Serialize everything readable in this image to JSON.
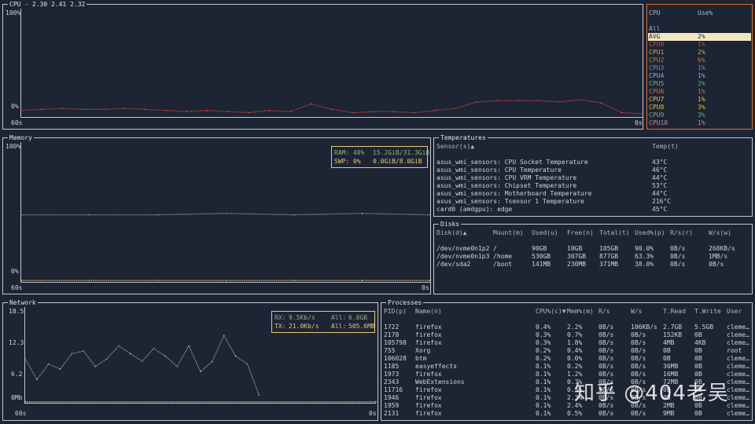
{
  "cpu": {
    "title": "CPU - 2.30 2.41 2.32",
    "y_top": "100%",
    "y_bottom": "0%",
    "x_left": "60s",
    "x_right": "0s",
    "line_color": "#c74848",
    "chart_data": {
      "type": "line",
      "x": [
        60,
        58,
        56,
        54,
        52,
        50,
        48,
        46,
        44,
        42,
        40,
        38,
        36,
        34,
        32,
        30,
        28,
        26,
        24,
        22,
        20,
        18,
        16,
        14,
        12,
        10,
        8,
        6,
        4,
        2,
        0
      ],
      "values": [
        6,
        7,
        8,
        7,
        7,
        8,
        7,
        6,
        5,
        6,
        5,
        4,
        6,
        5,
        12,
        7,
        4,
        5,
        5,
        4,
        6,
        8,
        14,
        15,
        15,
        15,
        14,
        16,
        13,
        4,
        3
      ],
      "ylim": [
        0,
        100
      ]
    }
  },
  "cpu_list": {
    "header_cpu": "CPU",
    "header_use": "Use%",
    "items": [
      {
        "name": "All",
        "use": "",
        "color": "#7fb8d6"
      },
      {
        "name": "AVG",
        "use": "2%",
        "color": "#2a2a2a",
        "selected": true
      },
      {
        "name": "CPU0",
        "use": "1%",
        "color": "#c74848"
      },
      {
        "name": "CPU1",
        "use": "2%",
        "color": "#d5b24a"
      },
      {
        "name": "CPU2",
        "use": "6%",
        "color": "#e0702a"
      },
      {
        "name": "CPU3",
        "use": "1%",
        "color": "#5f9aae"
      },
      {
        "name": "CPU4",
        "use": "1%",
        "color": "#7fb8d6"
      },
      {
        "name": "CPU5",
        "use": "2%",
        "color": "#7fa98e"
      },
      {
        "name": "CPU6",
        "use": "1%",
        "color": "#e0702a"
      },
      {
        "name": "CPU7",
        "use": "1%",
        "color": "#e6c35c"
      },
      {
        "name": "CPU8",
        "use": "3%",
        "color": "#f0c020"
      },
      {
        "name": "CPU9",
        "use": "3%",
        "color": "#7fa98e"
      },
      {
        "name": "CPU10",
        "use": "1%",
        "color": "#d47fb0"
      }
    ]
  },
  "memory": {
    "title": "Memory",
    "y_top": "100%",
    "y_bottom": "0%",
    "x_left": "60s",
    "x_right": "0s",
    "ram_label": "RAM:",
    "ram_pct": "48%",
    "ram_amount": "15.2GiB/31.3GiB",
    "swp_label": "SWP:",
    "swp_pct": "0%",
    "swp_amount": "0.0GiB/8.0GiB",
    "ram_color": "#8fb08a",
    "swp_color": "#e8c87a",
    "chart_data": {
      "type": "line",
      "x": [
        60,
        50,
        40,
        30,
        20,
        10,
        0
      ],
      "series": [
        {
          "name": "RAM",
          "values": [
            48,
            48,
            48,
            49,
            48,
            49,
            48
          ]
        },
        {
          "name": "SWP",
          "values": [
            0,
            0,
            0,
            0,
            0,
            0,
            0
          ]
        }
      ],
      "ylim": [
        0,
        100
      ]
    }
  },
  "temps": {
    "title": "Temperatures",
    "header_sensor": "Sensor(s)▲",
    "header_temp": "Temp(t)",
    "rows": [
      {
        "sensor": "asus_wmi_sensors: CPU Socket Temperature",
        "temp": "43°C"
      },
      {
        "sensor": "asus_wmi_sensors: CPU Temperature",
        "temp": "46°C"
      },
      {
        "sensor": "asus_wmi_sensors: CPU VRM Temperature",
        "temp": "44°C"
      },
      {
        "sensor": "asus_wmi_sensors: Chipset Temperature",
        "temp": "53°C"
      },
      {
        "sensor": "asus_wmi_sensors: Motherboard Temperature",
        "temp": "44°C"
      },
      {
        "sensor": "asus_wmi_sensors: Tsensor 1 Temperature",
        "temp": "216°C"
      },
      {
        "sensor": "card0 (amdgpu): edge",
        "temp": "45°C"
      }
    ]
  },
  "disks": {
    "title": "Disks",
    "headers": [
      "Disk(d)▲",
      "Mount(m)",
      "Used(u)",
      "Free(n)",
      "Total(t)",
      "Used%(p)",
      "R/s(r)",
      "W/s(w)"
    ],
    "rows": [
      [
        "/dev/nvme0n1p2",
        "/",
        "90GB",
        "10GB",
        "105GB",
        "90.0%",
        "0B/s",
        "268KB/s"
      ],
      [
        "/dev/nvme0n1p3",
        "/home",
        "530GB",
        "307GB",
        "877GB",
        "63.3%",
        "0B/s",
        "1MB/s"
      ],
      [
        "/dev/sda2",
        "/boot",
        "141MB",
        "230MB",
        "371MB",
        "38.0%",
        "0B/s",
        "0B/s"
      ]
    ]
  },
  "network": {
    "title": "Network",
    "y_labels": [
      "18.5",
      "12.3",
      "6.2",
      "0Mb"
    ],
    "x_left": "60s",
    "x_right": "0s",
    "rx_label": "RX:",
    "rx_rate": "9.5Kb/s",
    "rx_all_label": "All:",
    "rx_all": "6.8GB",
    "tx_label": "TX:",
    "tx_rate": "21.0Kb/s",
    "tx_all_label": "All:",
    "tx_all": "505.6MB",
    "rx_color": "#8fb08a",
    "tx_color": "#e8c87a",
    "chart_data": {
      "type": "line",
      "x": [
        60,
        58,
        56,
        54,
        52,
        50,
        48,
        46,
        44,
        42,
        40,
        38,
        36,
        34,
        32,
        30,
        28,
        26,
        24,
        22,
        20
      ],
      "series": [
        {
          "name": "RX",
          "values": [
            8.5,
            4.5,
            7.5,
            6.5,
            9.5,
            10,
            7,
            8.5,
            11,
            9.5,
            8,
            10.5,
            9,
            7,
            11,
            6,
            8,
            13,
            9,
            7.5,
            1.5
          ]
        },
        {
          "name": "TX",
          "values": [
            0.2,
            0.2,
            0.2,
            0.2,
            0.2,
            0.2,
            0.2,
            0.2,
            0.2,
            0.2,
            0.2,
            0.2,
            0.2,
            0.2,
            0.2,
            0.2,
            0.2,
            0.2,
            0.2,
            0.2,
            0.2
          ]
        }
      ],
      "ylim": [
        0,
        18.5
      ]
    }
  },
  "processes": {
    "title": "Processes",
    "headers": [
      "PID(p)",
      "Name(n)",
      "CPU%(c)▼",
      "Mem%(m)",
      "R/s",
      "W/s",
      "T.Read",
      "T.Write",
      "User"
    ],
    "rows": [
      [
        "1722",
        "firefox",
        "0.4%",
        "2.2%",
        "0B/s",
        "106KB/s",
        "2.7GB",
        "5.5GB",
        "cleme…"
      ],
      [
        "2178",
        "firefox",
        "0.3%",
        "0.7%",
        "0B/s",
        "0B/s",
        "152KB",
        "0B",
        "cleme…"
      ],
      [
        "105798",
        "firefox",
        "0.3%",
        "1.8%",
        "0B/s",
        "0B/s",
        "4MB",
        "4KB",
        "cleme…"
      ],
      [
        "755",
        "Xorg",
        "0.2%",
        "0.4%",
        "0B/s",
        "0B/s",
        "0B",
        "0B",
        "root"
      ],
      [
        "106028",
        "btm",
        "0.2%",
        "0.0%",
        "0B/s",
        "0B/s",
        "0B",
        "0B",
        "cleme…"
      ],
      [
        "1185",
        "easyeffects",
        "0.1%",
        "0.2%",
        "0B/s",
        "0B/s",
        "36MB",
        "0B",
        "cleme…"
      ],
      [
        "1973",
        "firefox",
        "0.1%",
        "1.2%",
        "0B/s",
        "0B/s",
        "16MB",
        "0B",
        "cleme…"
      ],
      [
        "2343",
        "WebExtensions",
        "0.1%",
        "0.7%",
        "0B/s",
        "0B/s",
        "72MB",
        "0B",
        "cleme…"
      ],
      [
        "11716",
        "firefox",
        "0.1%",
        "0.5%",
        "0B/s",
        "0B/s",
        "0B",
        "0B",
        "cleme…"
      ],
      [
        "1946",
        "firefox",
        "0.1%",
        "2.3%",
        "0B/s",
        "0B/s",
        "0B",
        "0B",
        "cleme…"
      ],
      [
        "1959",
        "firefox",
        "0.1%",
        "2.4%",
        "0B/s",
        "0B/s",
        "2MB",
        "0B",
        "cleme…"
      ],
      [
        "2131",
        "firefox",
        "0.1%",
        "0.5%",
        "0B/s",
        "0B/s",
        "9MB",
        "0B",
        "cleme…"
      ]
    ]
  },
  "watermark": "知乎 @404老吴"
}
